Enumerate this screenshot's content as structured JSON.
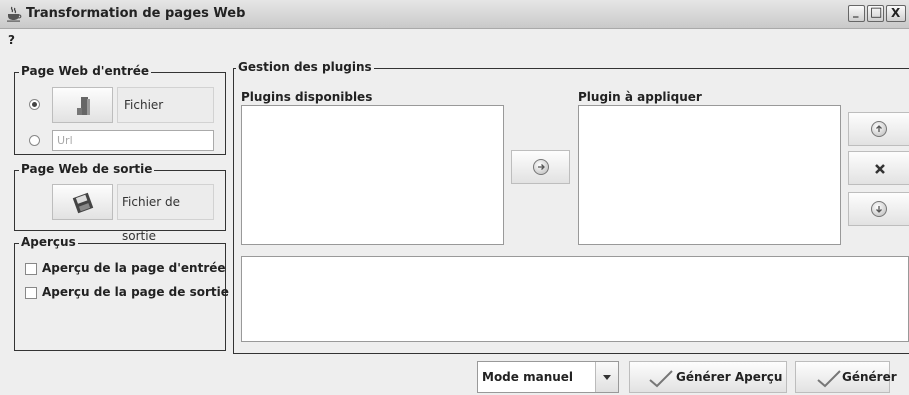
{
  "window": {
    "title": "Transformation de pages Web",
    "controls": {
      "minimize": "_",
      "maximize": "□",
      "close": "X"
    }
  },
  "menubar": {
    "help": "?"
  },
  "input_page": {
    "legend": "Page Web d'entrée",
    "file_label": "Fichier",
    "url_placeholder": "Url",
    "file_selected": true
  },
  "output_page": {
    "legend": "Page Web de sortie",
    "file_label": "Fichier de sortie"
  },
  "previews": {
    "legend": "Aperçus",
    "input_label": "Aperçu de la page d'entrée",
    "output_label": "Aperçu de la page de sortie"
  },
  "plugins": {
    "legend": "Gestion des plugins",
    "available_label": "Plugins disponibles",
    "apply_label": "Plugin à appliquer",
    "available": [],
    "to_apply": []
  },
  "bottom": {
    "mode_value": "Mode manuel",
    "generate_preview_label": "Générer Aperçu",
    "generate_label": "Générer"
  }
}
